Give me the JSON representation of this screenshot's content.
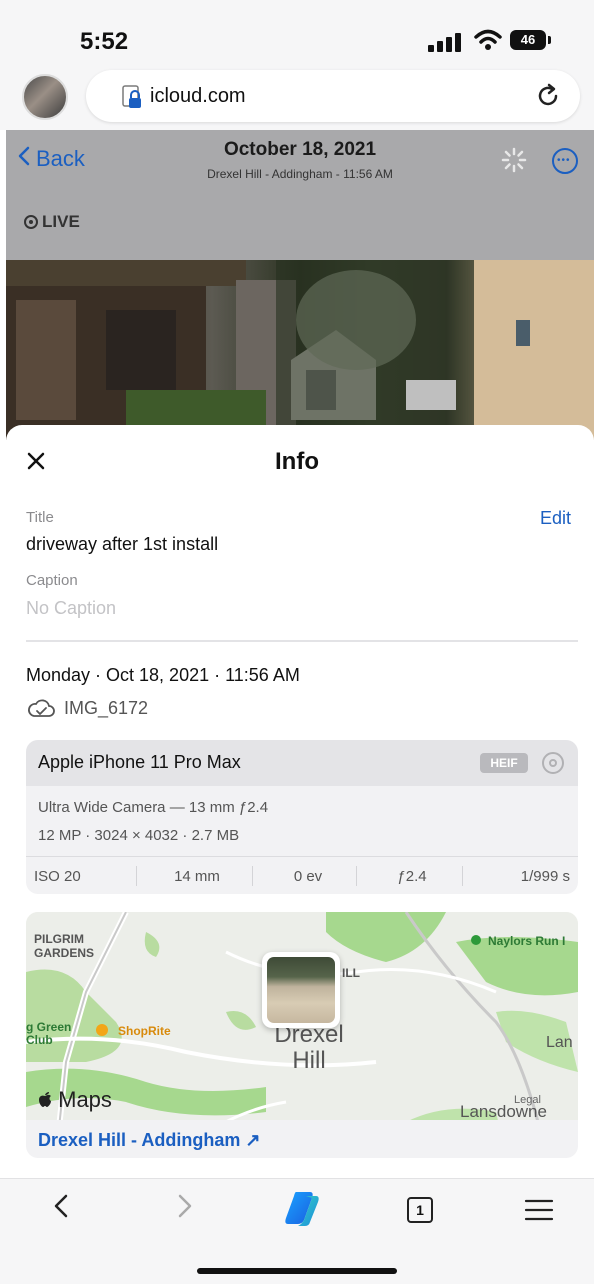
{
  "status_bar": {
    "time": "5:52",
    "battery": "46"
  },
  "browser": {
    "url": "icloud.com"
  },
  "photo_header": {
    "back_label": "Back",
    "date": "October 18, 2021",
    "subtitle": "Drexel Hill - Addingham - 11:56 AM",
    "live_label": "LIVE"
  },
  "info": {
    "sheet_title": "Info",
    "title_label": "Title",
    "edit_label": "Edit",
    "title_value": "driveway after 1st install",
    "caption_label": "Caption",
    "caption_placeholder": "No Caption",
    "datetime": "Monday · Oct 18, 2021 · 11:56 AM",
    "filename": "IMG_6172"
  },
  "camera": {
    "device": "Apple iPhone 11 Pro Max",
    "format_badge": "HEIF",
    "lens": "Ultra Wide Camera — 13 mm ƒ2.4",
    "file_details": "12 MP · 3024 × 4032 · 2.7 MB",
    "exif": [
      "ISO 20",
      "14 mm",
      "0 ev",
      "ƒ2.4",
      "1/999 s"
    ]
  },
  "map": {
    "labels": {
      "pilgrim": "PILGRIM",
      "gardens": "GARDENS",
      "naylors": "Naylors Run I",
      "green": "g Green",
      "club": "Club",
      "shoprite": "ShopRite",
      "hill_small": "ILL",
      "town_line1": "Drexel",
      "town_line2": "Hill",
      "lan": "Lan",
      "lansdowne": "Lansdowne"
    },
    "maps_brand": "Maps",
    "legal": "Legal",
    "location_link": "Drexel Hill - Addingham ↗"
  },
  "toolbar": {
    "back": "‹",
    "forward": "›",
    "tab_count": "1"
  },
  "colors": {
    "accent": "#1b5fc1",
    "sheet_bg": "#ffffff",
    "header_bg": "#a9a9ab"
  }
}
